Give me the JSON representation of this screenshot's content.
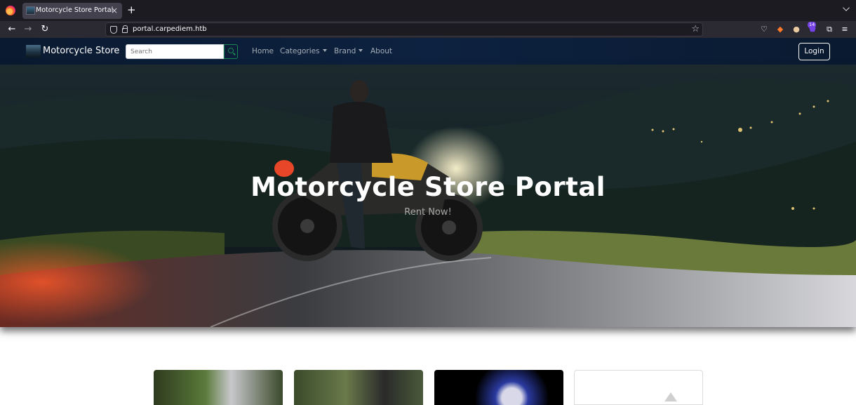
{
  "browser": {
    "tab_title": "Motorcycle Store Portal",
    "tab_close": "×",
    "new_tab": "+",
    "url": "portal.carpediem.htb",
    "badge_count": "14"
  },
  "site": {
    "brand": "Motorcycle Store",
    "search_placeholder": "Search",
    "nav": {
      "home": "Home",
      "categories": "Categories",
      "brand": "Brand",
      "about": "About"
    },
    "login": "Login"
  },
  "hero": {
    "title": "Motorcycle Store Portal",
    "subtitle": "Rent Now!"
  },
  "colors": {
    "navbar": "#0d2240",
    "search_accent": "#198754",
    "browser_bg": "#1c1b22"
  }
}
